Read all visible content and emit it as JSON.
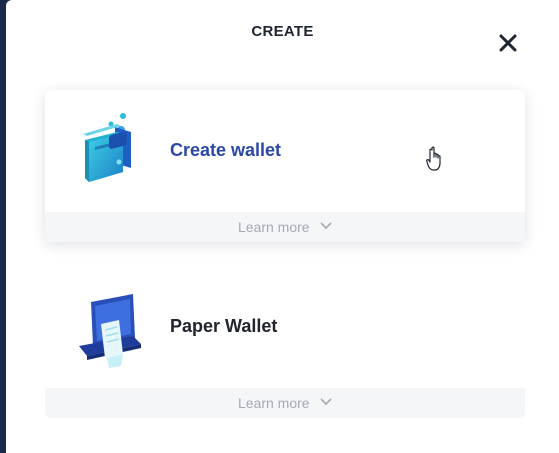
{
  "modal": {
    "title": "CREATE",
    "close_icon": "close-icon"
  },
  "options": [
    {
      "label": "Create wallet",
      "label_color": "#2b48a6",
      "icon": "wallet-icon",
      "learn_more": "Learn more",
      "chevron": "chevron-down-icon"
    },
    {
      "label": "Paper Wallet",
      "label_color": "#20242c",
      "icon": "paper-wallet-icon",
      "learn_more": "Learn more",
      "chevron": "chevron-down-icon"
    }
  ],
  "colors": {
    "accent": "#2b48a6",
    "teal": "#2bbcd6",
    "muted_text": "#a4a9b3",
    "footer_bg": "#f5f6f8"
  }
}
